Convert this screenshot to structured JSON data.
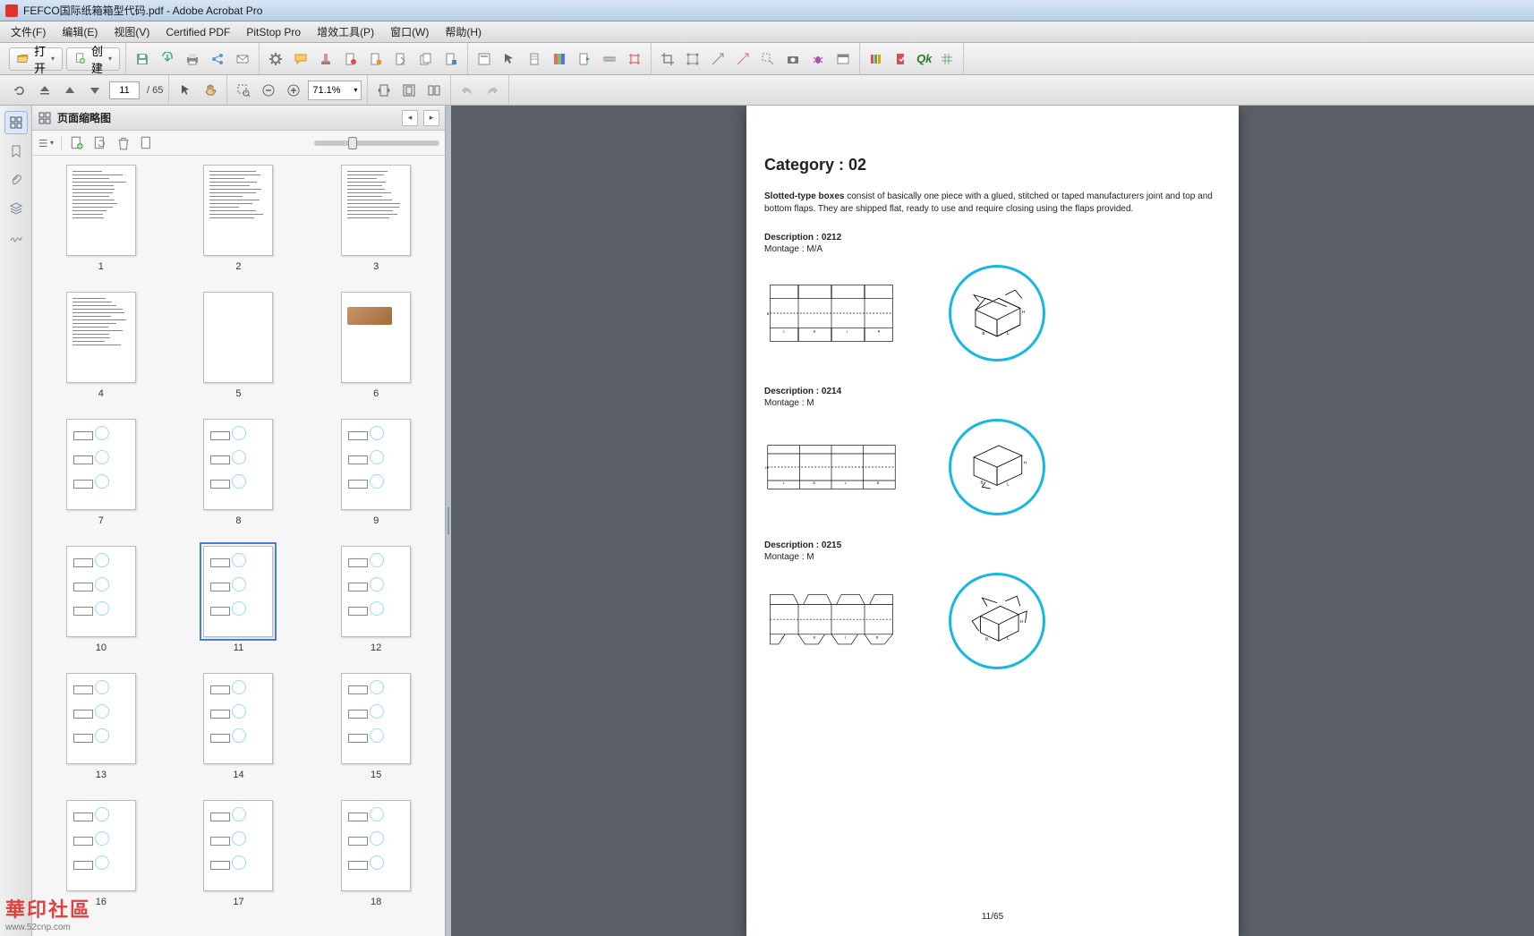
{
  "window": {
    "title": "FEFCO国际纸箱箱型代码.pdf - Adobe Acrobat Pro"
  },
  "menu": {
    "items": [
      "文件(F)",
      "编辑(E)",
      "视图(V)",
      "Certified PDF",
      "PitStop Pro",
      "增效工具(P)",
      "窗口(W)",
      "帮助(H)"
    ]
  },
  "toolbar": {
    "open": "打开",
    "create": "创建"
  },
  "nav": {
    "page": "11",
    "total": "/ 65",
    "zoom": "71.1%"
  },
  "panel": {
    "title": "页面缩略图"
  },
  "thumbs": [
    {
      "n": "1",
      "t": "doc"
    },
    {
      "n": "2",
      "t": "doc"
    },
    {
      "n": "3",
      "t": "doc"
    },
    {
      "n": "4",
      "t": "doc"
    },
    {
      "n": "5",
      "t": "blank"
    },
    {
      "n": "6",
      "t": "img"
    },
    {
      "n": "7",
      "t": "fig"
    },
    {
      "n": "8",
      "t": "fig"
    },
    {
      "n": "9",
      "t": "fig"
    },
    {
      "n": "10",
      "t": "fig"
    },
    {
      "n": "11",
      "t": "fig",
      "sel": true
    },
    {
      "n": "12",
      "t": "fig"
    },
    {
      "n": "13",
      "t": "fig"
    },
    {
      "n": "14",
      "t": "fig"
    },
    {
      "n": "15",
      "t": "fig"
    },
    {
      "n": "16",
      "t": "fig"
    },
    {
      "n": "17",
      "t": "fig"
    },
    {
      "n": "18",
      "t": "fig"
    }
  ],
  "doc": {
    "category_label": "Category : 02",
    "intro_b": "Slotted-type boxes",
    "intro": " consist of basically one piece with a glued, stitched or taped manufacturers joint and top and bottom flaps. They are shipped flat, ready to use and require closing using the flaps provided.",
    "entries": [
      {
        "desc_l": "Description : ",
        "code": "0212",
        "mont_l": "Montage : ",
        "mont": "M/A"
      },
      {
        "desc_l": "Description : ",
        "code": "0214",
        "mont_l": "Montage : ",
        "mont": "M"
      },
      {
        "desc_l": "Description : ",
        "code": "0215",
        "mont_l": "Montage : ",
        "mont": "M"
      }
    ],
    "pagenum": "11/65"
  },
  "watermark": {
    "logo": "華印社區",
    "url": "www.52cnp.com"
  }
}
